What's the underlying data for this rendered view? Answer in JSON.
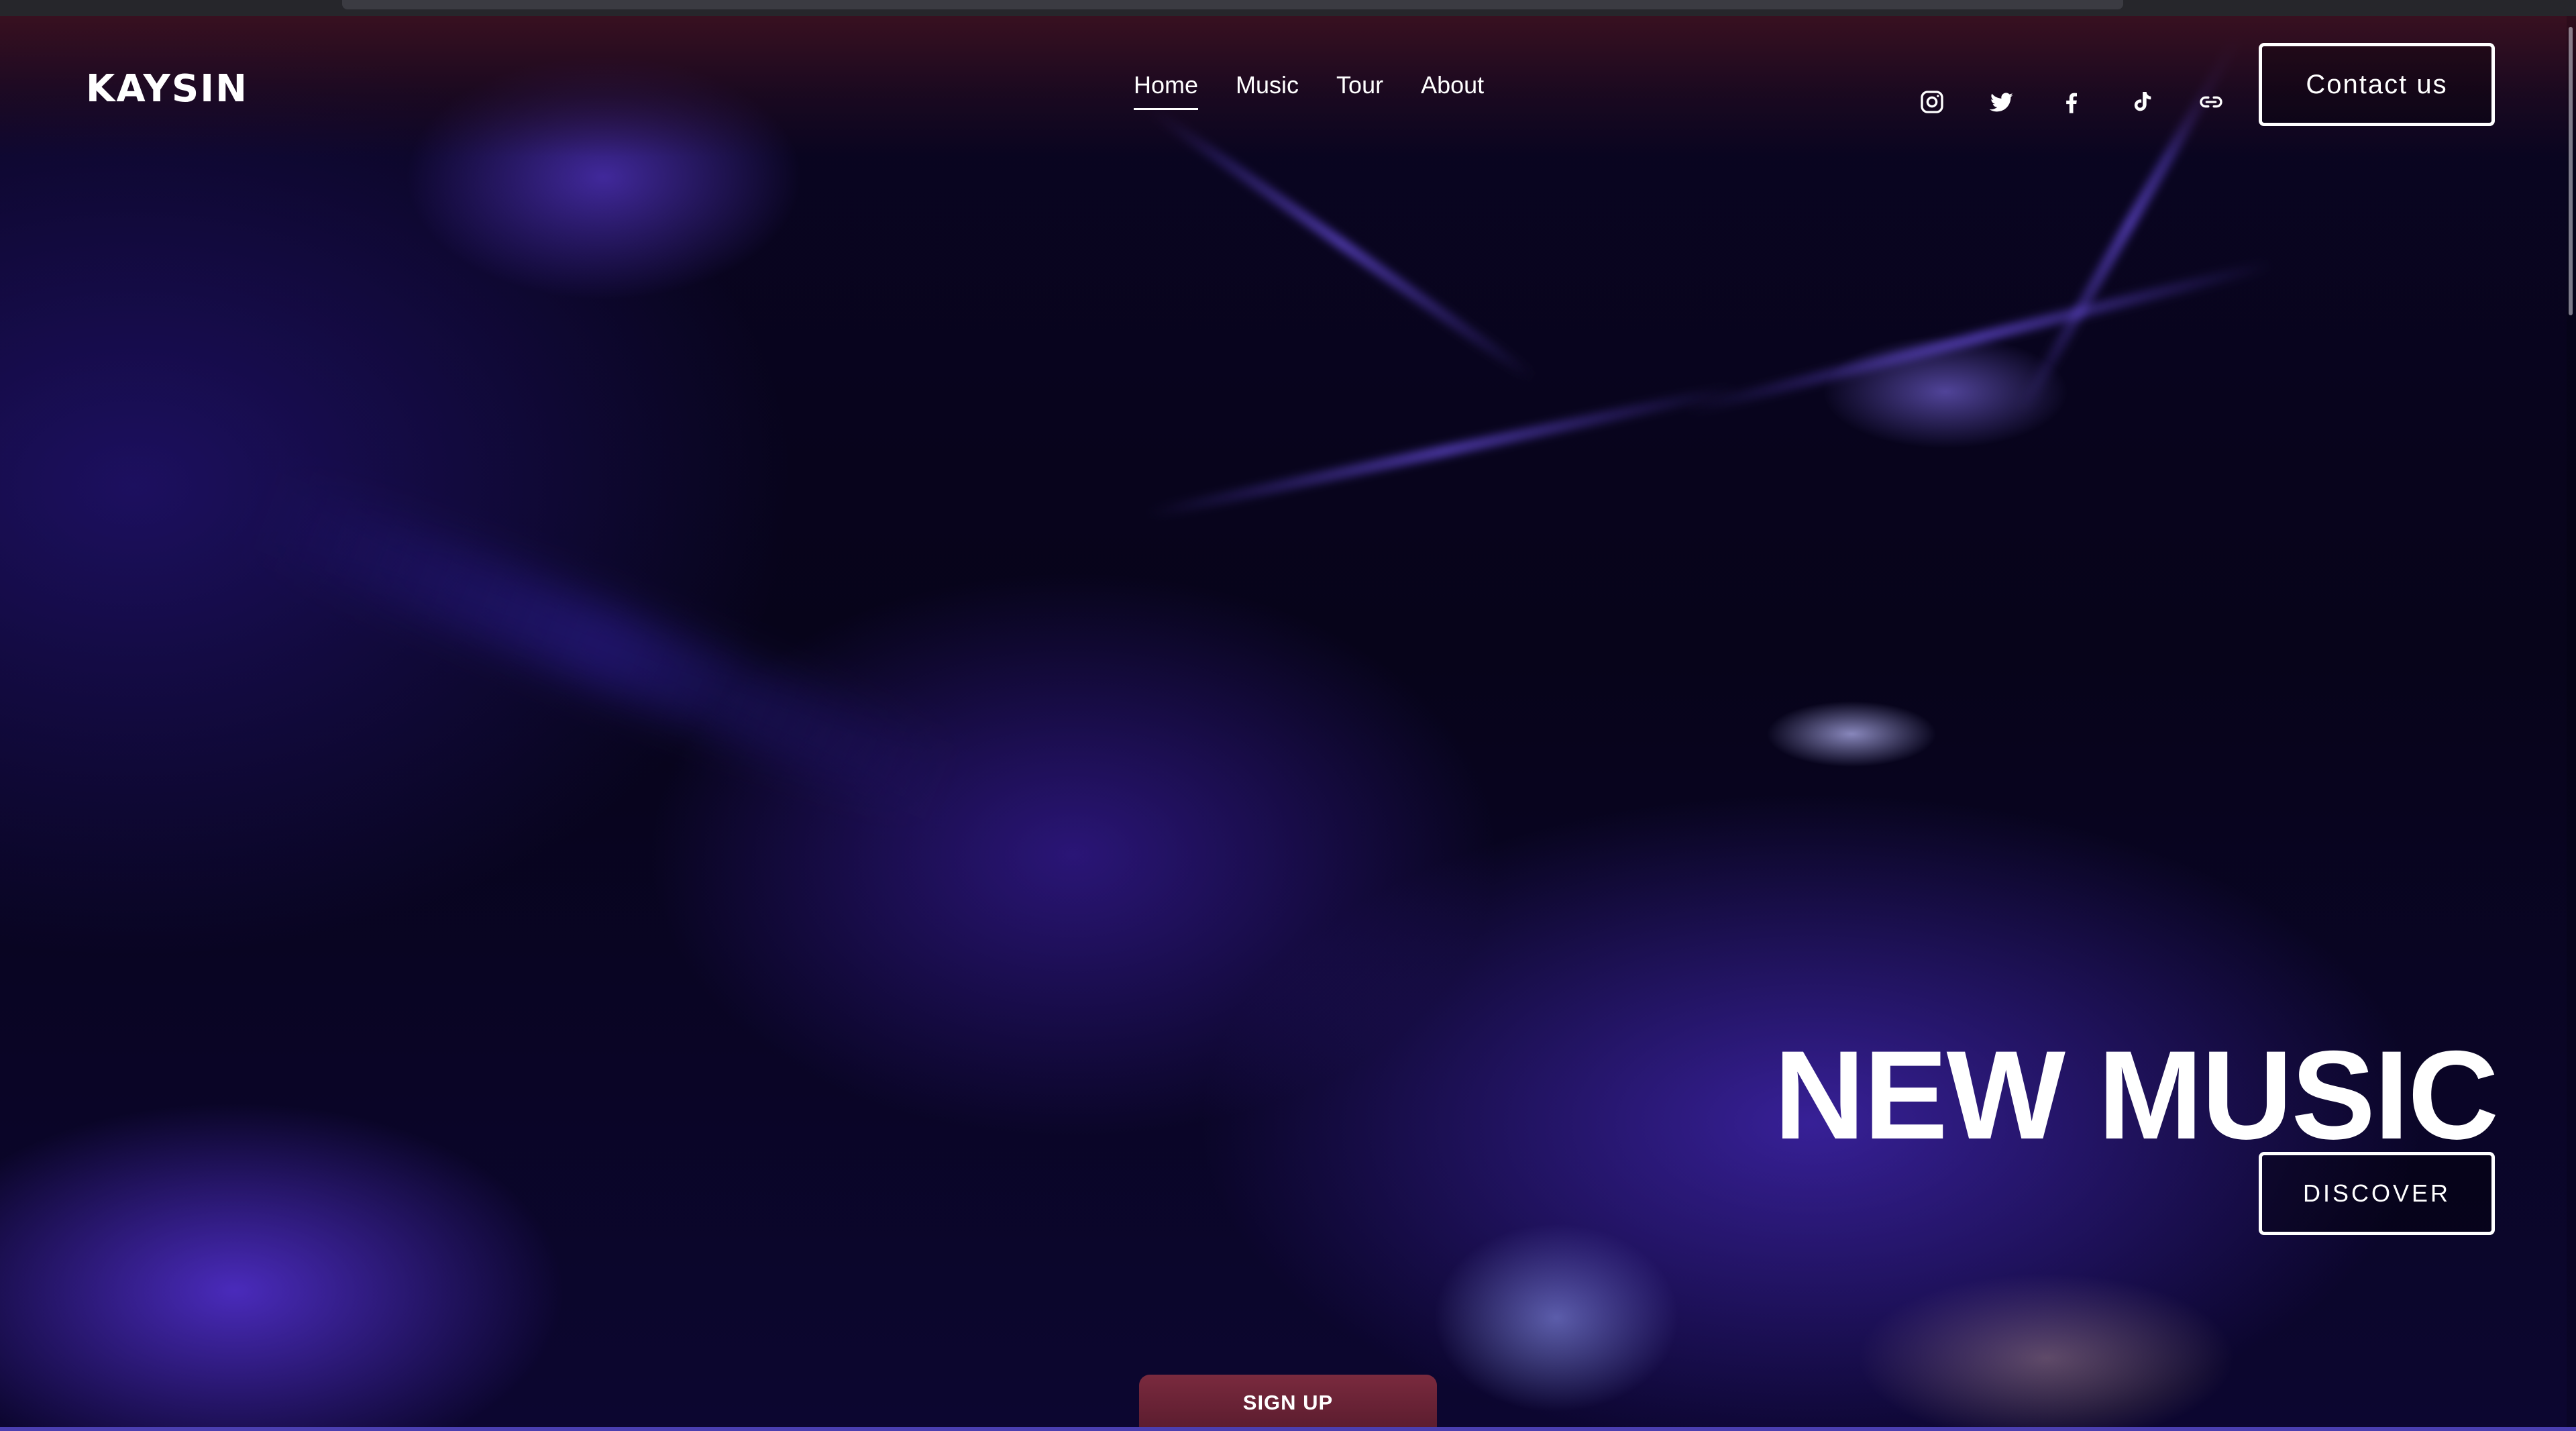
{
  "site": {
    "logo": "KAYSIN"
  },
  "nav": {
    "items": [
      {
        "label": "Home",
        "active": true
      },
      {
        "label": "Music",
        "active": false
      },
      {
        "label": "Tour",
        "active": false
      },
      {
        "label": "About",
        "active": false
      }
    ]
  },
  "socials": [
    {
      "icon": "instagram-icon"
    },
    {
      "icon": "twitter-icon"
    },
    {
      "icon": "facebook-icon"
    },
    {
      "icon": "tiktok-icon"
    },
    {
      "icon": "link-icon"
    }
  ],
  "header": {
    "contact_label": "Contact us"
  },
  "hero": {
    "title": "NEW MUSIC",
    "discover_label": "DISCOVER"
  },
  "footer": {
    "signup_label": "SIGN UP"
  },
  "colors": {
    "accent": "#ffffff",
    "signup_bg": "#6a2336",
    "hero_tint": "#2a1a9a"
  }
}
